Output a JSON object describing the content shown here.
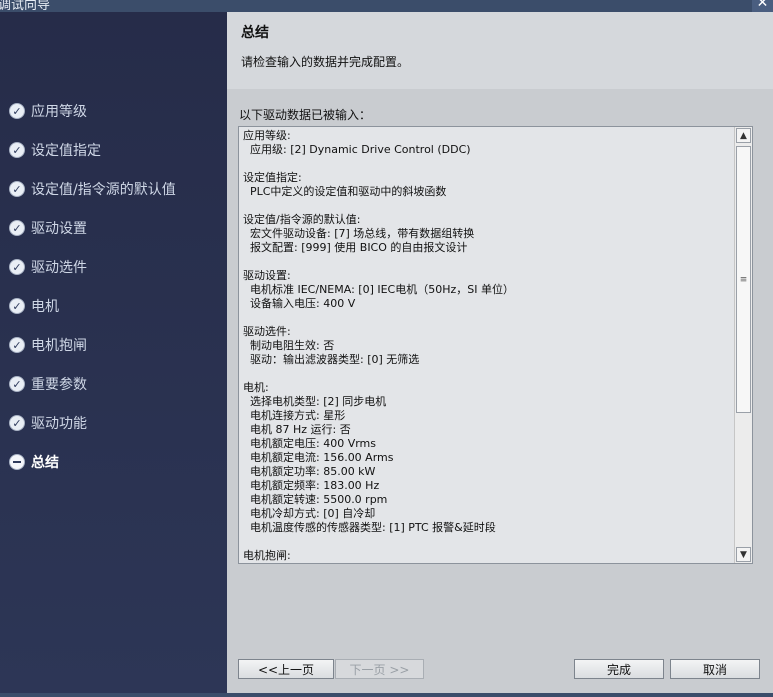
{
  "window": {
    "title": "调试向导",
    "close_label": "✕"
  },
  "sidebar": {
    "items": [
      {
        "label": "应用等级",
        "state": "done"
      },
      {
        "label": "设定值指定",
        "state": "done"
      },
      {
        "label": "设定值/指令源的默认值",
        "state": "done"
      },
      {
        "label": "驱动设置",
        "state": "done"
      },
      {
        "label": "驱动选件",
        "state": "done"
      },
      {
        "label": "电机",
        "state": "done"
      },
      {
        "label": "电机抱闸",
        "state": "done"
      },
      {
        "label": "重要参数",
        "state": "done"
      },
      {
        "label": "驱动功能",
        "state": "done"
      },
      {
        "label": "总结",
        "state": "active"
      }
    ]
  },
  "header": {
    "title": "总结",
    "subtitle": "请检查输入的数据并完成配置。"
  },
  "summary": {
    "intro": "以下驱动数据已被输入：",
    "lines": [
      "应用等级:",
      "  应用级: [2] Dynamic Drive Control (DDC)",
      "",
      "设定值指定:",
      "  PLC中定义的设定值和驱动中的斜坡函数",
      "",
      "设定值/指令源的默认值:",
      "  宏文件驱动设备: [7] 场总线，带有数据组转换",
      "  报文配置: [999] 使用 BICO 的自由报文设计",
      "",
      "驱动设置:",
      "  电机标准 IEC/NEMA: [0] IEC电机（50Hz，SI 单位）",
      "  设备输入电压: 400 V",
      "",
      "驱动选件:",
      "  制动电阻生效: 否",
      "  驱动：输出滤波器类型: [0] 无筛选",
      "",
      "电机:",
      "  选择电机类型: [2] 同步电机",
      "  电机连接方式: 星形",
      "  电机 87 Hz 运行: 否",
      "  电机额定电压: 400 Vrms",
      "  电机额定电流: 156.00 Arms",
      "  电机额定功率: 85.00 kW",
      "  电机额定频率: 183.00 Hz",
      "  电机额定转速: 5500.0 rpm",
      "  电机冷却方式: [0] 自冷却",
      "  电机温度传感的传感器类型: [1] PTC 报警&延时段",
      "",
      "电机抱闸:"
    ],
    "scroll_up": "▲",
    "scroll_down": "▼",
    "thumb_grip": "≡"
  },
  "buttons": {
    "prev": "<<上一页",
    "next": "下一页 >>",
    "finish": "完成",
    "cancel": "取消"
  }
}
